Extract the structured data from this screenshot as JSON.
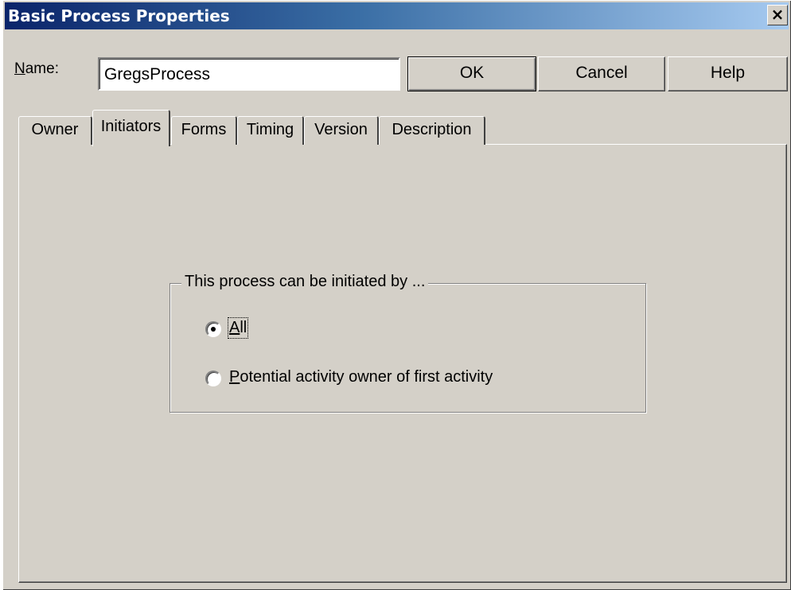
{
  "window": {
    "title": "Basic Process Properties",
    "close_label": "×"
  },
  "form": {
    "name_label_mnemonic": "N",
    "name_label_rest": "ame:",
    "name_value": "GregsProcess"
  },
  "buttons": {
    "ok": "OK",
    "cancel": "Cancel",
    "help": "Help"
  },
  "tabs": [
    {
      "label": "Owner"
    },
    {
      "label": "Initiators",
      "selected": true
    },
    {
      "label": "Forms"
    },
    {
      "label": "Timing"
    },
    {
      "label": "Version"
    },
    {
      "label": "Description"
    }
  ],
  "initiators": {
    "group_label": "This process can be initiated by ...",
    "options": [
      {
        "mnemonic": "A",
        "rest": "ll",
        "checked": true
      },
      {
        "mnemonic": "P",
        "rest": "otential activity owner of first activity",
        "checked": false
      }
    ]
  },
  "colors": {
    "face": "#d4d0c8",
    "title_start": "#0a246a",
    "title_end": "#a6caf0"
  }
}
